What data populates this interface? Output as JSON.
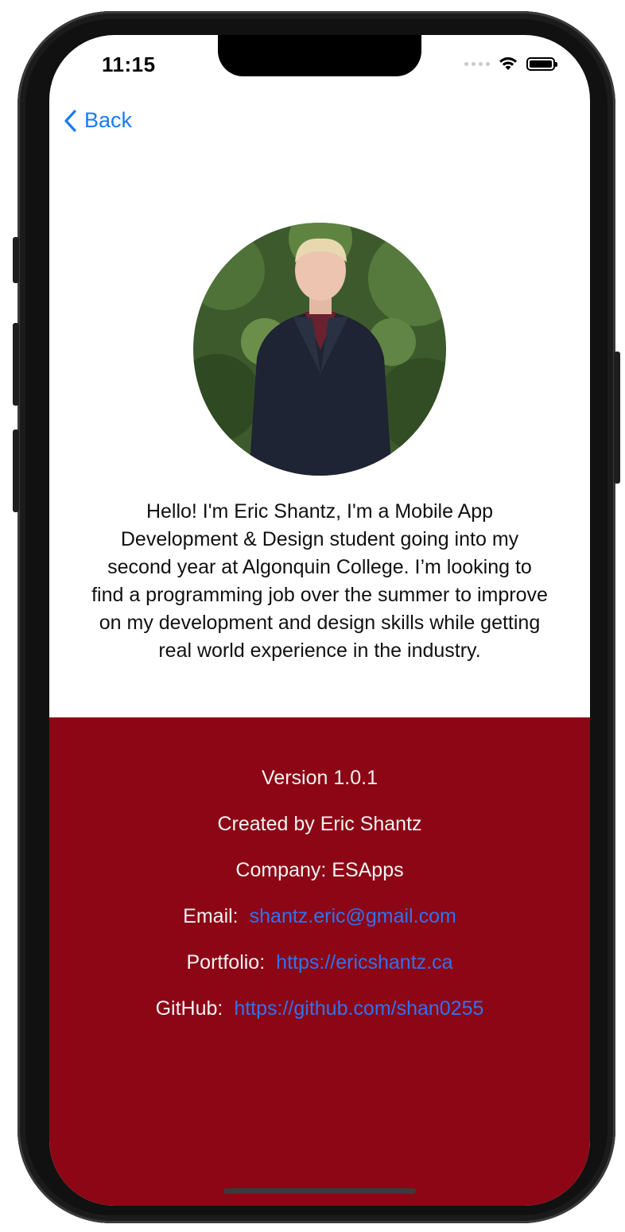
{
  "status_bar": {
    "time": "11:15"
  },
  "nav": {
    "back_label": "Back"
  },
  "profile": {
    "bio": "Hello! I'm Eric Shantz, I'm a Mobile App Development & Design student going into my second year at Algonquin College. I’m looking to find a programming job over the summer to improve on my development and design skills while getting real world experience in the industry."
  },
  "info": {
    "version": "Version 1.0.1",
    "created_by": "Created by Eric Shantz",
    "company": "Company: ESApps",
    "email_label": "Email:",
    "email_value": "shantz.eric@gmail.com",
    "portfolio_label": "Portfolio:",
    "portfolio_value": "https://ericshantz.ca",
    "github_label": "GitHub:",
    "github_value": "https://github.com/shan0255"
  },
  "colors": {
    "accent": "#1a7cf0",
    "footer_bg": "#8c0615",
    "link": "#2f73f0"
  }
}
